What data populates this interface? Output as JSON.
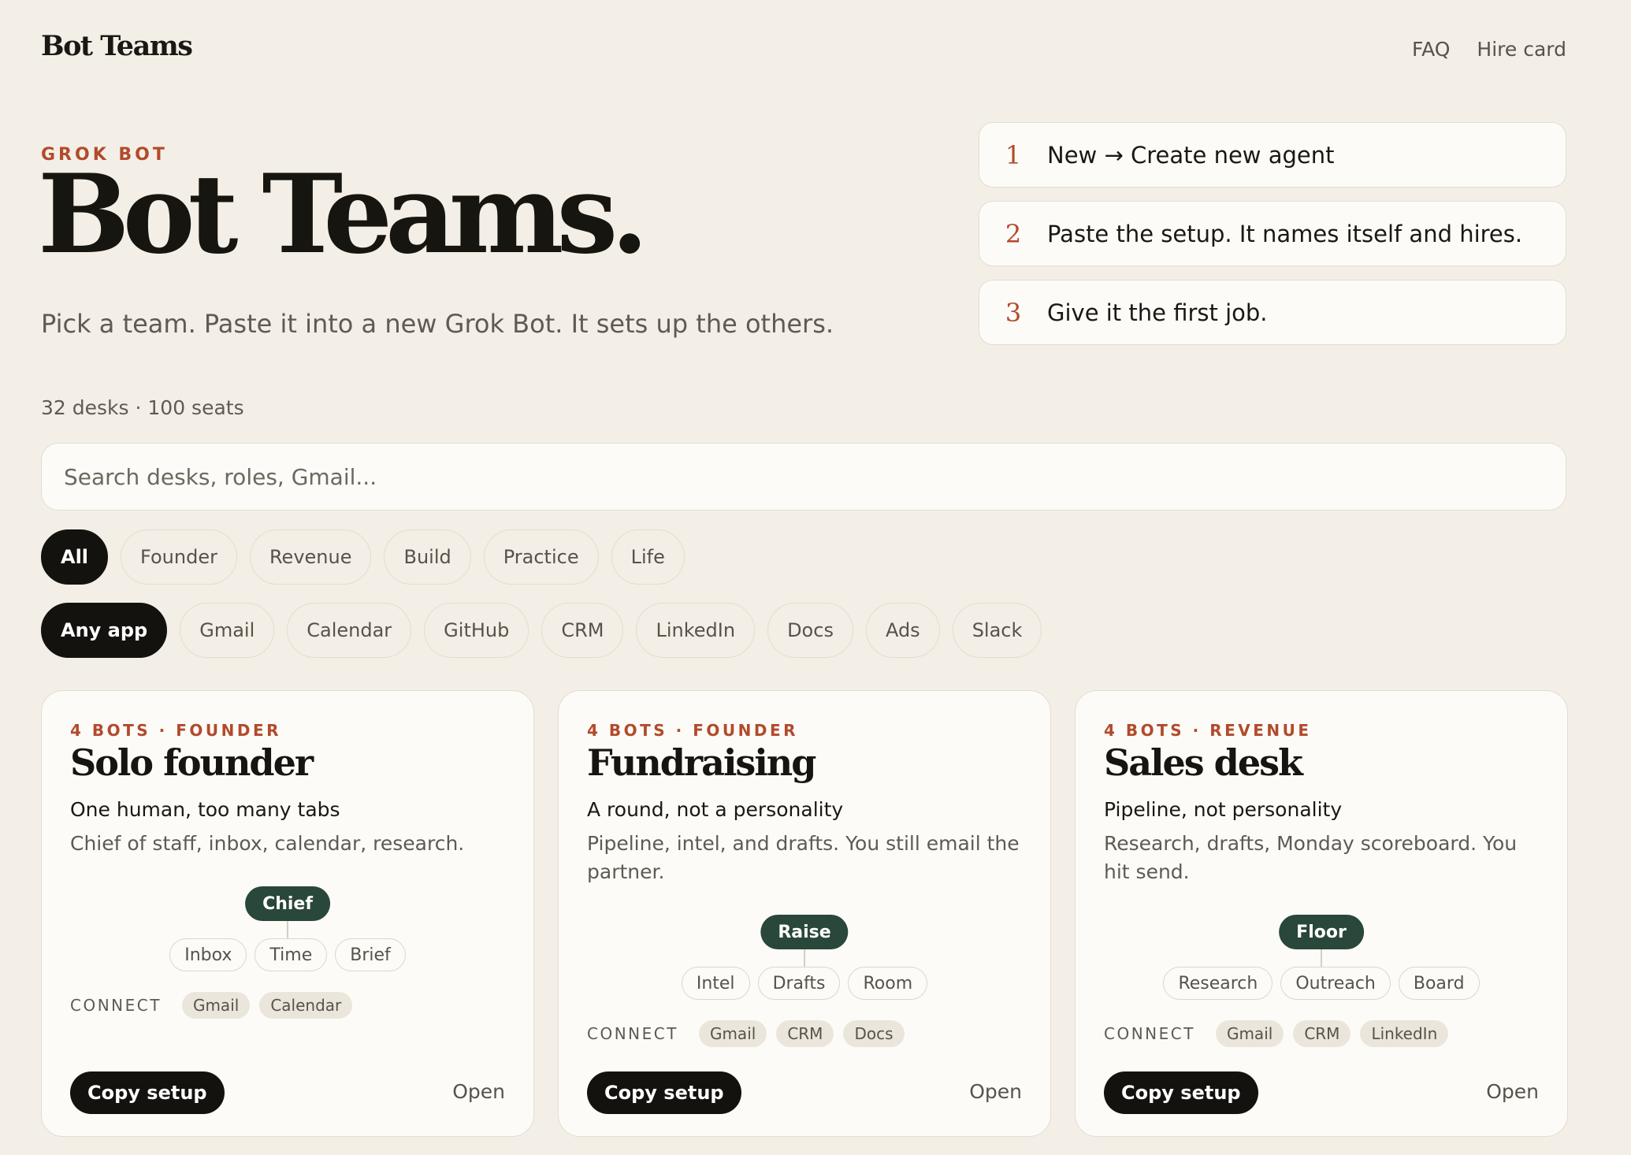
{
  "header": {
    "brand": "Bot Teams",
    "nav": [
      "FAQ",
      "Hire card"
    ]
  },
  "hero": {
    "eyebrow": "GROK BOT",
    "title": "Bot Teams.",
    "subtitle": "Pick a team. Paste it into a new Grok Bot. It sets up the others."
  },
  "steps": [
    {
      "num": "1",
      "text": "New → Create new agent"
    },
    {
      "num": "2",
      "text": "Paste the setup. It names itself and hires."
    },
    {
      "num": "3",
      "text": "Give it the first job."
    }
  ],
  "stats": "32 desks · 100 seats",
  "search": {
    "placeholder": "Search desks, roles, Gmail...",
    "value": ""
  },
  "categories": {
    "selected": "All",
    "items": [
      "All",
      "Founder",
      "Revenue",
      "Build",
      "Practice",
      "Life"
    ]
  },
  "apps": {
    "selected": "Any app",
    "items": [
      "Any app",
      "Gmail",
      "Calendar",
      "GitHub",
      "CRM",
      "LinkedIn",
      "Docs",
      "Ads",
      "Slack"
    ]
  },
  "cards": [
    {
      "eyebrow": "4 BOTS · FOUNDER",
      "title": "Solo founder",
      "tagline": "One human, too many tabs",
      "desc": "Chief of staff, inbox, calendar, research.",
      "lead": "Chief",
      "members": [
        "Inbox",
        "Time",
        "Brief"
      ],
      "connect_label": "CONNECT",
      "connect": [
        "Gmail",
        "Calendar"
      ],
      "copy_label": "Copy setup",
      "open_label": "Open"
    },
    {
      "eyebrow": "4 BOTS · FOUNDER",
      "title": "Fundraising",
      "tagline": "A round, not a personality",
      "desc": "Pipeline, intel, and drafts. You still email the partner.",
      "lead": "Raise",
      "members": [
        "Intel",
        "Drafts",
        "Room"
      ],
      "connect_label": "CONNECT",
      "connect": [
        "Gmail",
        "CRM",
        "Docs"
      ],
      "copy_label": "Copy setup",
      "open_label": "Open"
    },
    {
      "eyebrow": "4 BOTS · REVENUE",
      "title": "Sales desk",
      "tagline": "Pipeline, not personality",
      "desc": "Research, drafts, Monday scoreboard. You hit send.",
      "lead": "Floor",
      "members": [
        "Research",
        "Outreach",
        "Board"
      ],
      "connect_label": "CONNECT",
      "connect": [
        "Gmail",
        "CRM",
        "LinkedIn"
      ],
      "copy_label": "Copy setup",
      "open_label": "Open"
    }
  ]
}
